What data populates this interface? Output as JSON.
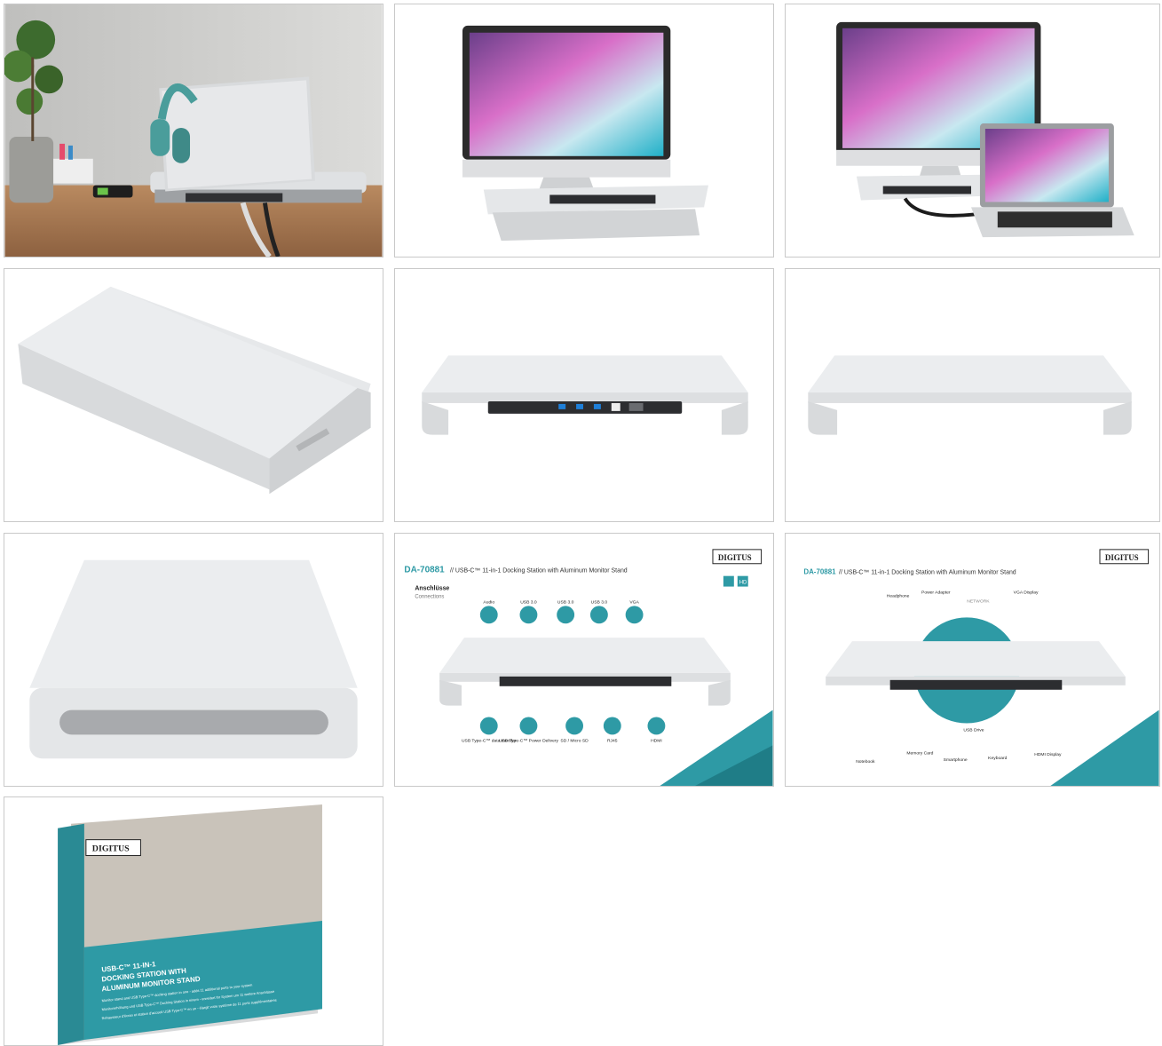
{
  "gallery": {
    "tiles": [
      {
        "id": 1,
        "kind": "photo"
      },
      {
        "id": 2,
        "kind": "photo"
      },
      {
        "id": 3,
        "kind": "photo"
      },
      {
        "id": 4,
        "kind": "photo"
      },
      {
        "id": 5,
        "kind": "photo"
      },
      {
        "id": 6,
        "kind": "photo"
      },
      {
        "id": 7,
        "kind": "photo"
      },
      {
        "id": 8,
        "kind": "infographic"
      },
      {
        "id": 9,
        "kind": "infographic"
      },
      {
        "id": 10,
        "kind": "photo"
      }
    ]
  },
  "infographic": {
    "model": "DA-70881",
    "title": "// USB-C™ 11-in-1 Docking Station with Aluminum Monitor Stand",
    "brand": "DIGITUS",
    "section_de": "Anschlüsse",
    "section_en": "Connections",
    "top_ports": [
      "Audio",
      "USB 3.0",
      "USB 3.0",
      "USB 3.0",
      "VGA"
    ],
    "bottom_ports": [
      "USB Type-C™ data transfer",
      "USB Type-C™ Power Delivery",
      "SD / Micro SD",
      "RJ45",
      "HDMI"
    ],
    "badge": "HD"
  },
  "diagram": {
    "top_devices": [
      "Headphone",
      "Power Adapter",
      "NETWORK",
      "VGA Display"
    ],
    "bottom_devices": [
      "Notebook",
      "Memory Card",
      "Smartphone",
      "USB Drive",
      "Keyboard",
      "HDMI Display"
    ]
  },
  "box": {
    "brand": "DIGITUS",
    "headline_1": "USB-C™ 11-IN-1",
    "headline_2": "DOCKING STATION WITH",
    "headline_3": "ALUMINUM MONITOR STAND",
    "text_en": "Monitor stand and USB Type-C™ docking station in one - adds 11 additional ports to your system",
    "text_de": "Monitorerhöhung und USB Type-C™ Docking Station in einem - erweitert Ihr System um 11 weitere Anschlüsse",
    "text_fr": "Rehausseur d'écran et station d'accueil USB Type-C™ en un - élargit votre système de 11 ports supplémentaires"
  },
  "colors": {
    "teal": "#2e9aa5",
    "aluminum": "#e4e6e8",
    "border": "#c9c9c9"
  }
}
